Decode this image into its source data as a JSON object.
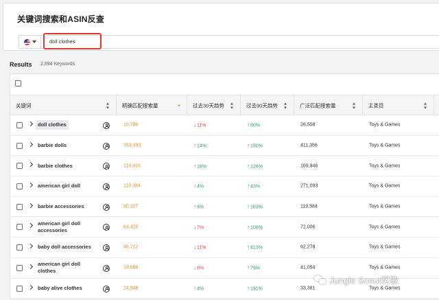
{
  "page": {
    "title": "关键词搜索和ASIN反查",
    "search": {
      "country_icon": "us-flag-icon",
      "value": "doll clothes"
    }
  },
  "results": {
    "title": "Results",
    "count": "2,894 Keywords"
  },
  "colors": {
    "accent_orange": "#e6922b",
    "trend_up": "#2ea36a",
    "trend_down": "#d64545",
    "highlight_border": "#e03a2c"
  },
  "table": {
    "headers": {
      "keyword": "关键词",
      "exact": "精确匹配搜索量",
      "trend30": "过去30天趋势",
      "trend90": "过去90天趋势",
      "broad": "广泛匹配搜索量",
      "category": "主类目"
    },
    "rows": [
      {
        "keyword": "doll clothes",
        "exact": "10,786",
        "t30": "11%",
        "t30_dir": "down",
        "t90": "80%",
        "t90_dir": "up",
        "broad": "26,558",
        "category": "Toys & Games"
      },
      {
        "keyword": "barbie dolls",
        "exact": "353,493",
        "t30": "14%",
        "t30_dir": "up",
        "t90": "150%",
        "t90_dir": "up",
        "broad": "411,356",
        "category": "Toys & Games"
      },
      {
        "keyword": "barbie clothes",
        "exact": "119,933",
        "t30": "16%",
        "t30_dir": "up",
        "t90": "126%",
        "t90_dir": "up",
        "broad": "169,946",
        "category": "Toys & Games"
      },
      {
        "keyword": "american girl doll",
        "exact": "110,384",
        "t30": "4%",
        "t30_dir": "up",
        "t90": "43%",
        "t90_dir": "up",
        "broad": "271,093",
        "category": "Toys & Games"
      },
      {
        "keyword": "barbie accessories",
        "exact": "80,327",
        "t30": "6%",
        "t30_dir": "up",
        "t90": "163%",
        "t90_dir": "up",
        "broad": "119,584",
        "category": "Toys & Games"
      },
      {
        "keyword": "american girl doll accessories",
        "exact": "64,425",
        "t30": "7%",
        "t30_dir": "down",
        "t90": "108%",
        "t90_dir": "up",
        "broad": "72,006",
        "category": "Toys & Games"
      },
      {
        "keyword": "baby doll accessories",
        "exact": "48,712",
        "t30": "11%",
        "t30_dir": "down",
        "t90": "413%",
        "t90_dir": "up",
        "broad": "62,278",
        "category": "Toys & Games"
      },
      {
        "keyword": "american girl doll clothes",
        "exact": "33,688",
        "t30": "8%",
        "t30_dir": "down",
        "t90": "79%",
        "t90_dir": "up",
        "broad": "41,054",
        "category": "Toys & Games"
      },
      {
        "keyword": "baby alive clothes",
        "exact": "24,948",
        "t30": "4%",
        "t30_dir": "up",
        "t90": "191%",
        "t90_dir": "up",
        "broad": "33,381",
        "category": "Toys & Games"
      }
    ]
  },
  "watermark": {
    "text": "Jungle Scout奖歌",
    "icon": "wechat-icon"
  }
}
